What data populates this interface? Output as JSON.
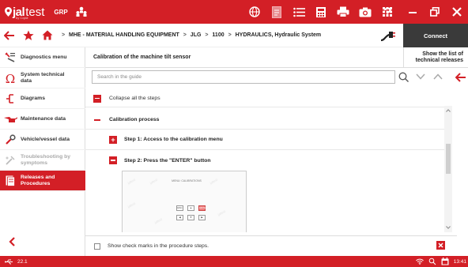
{
  "app": {
    "logo_primary": "jal",
    "logo_secondary": "test",
    "logo_subtitle": "by Cojali",
    "product": "GRP"
  },
  "breadcrumb": {
    "items": [
      "MHE - MATERIAL HANDLING EQUIPMENT",
      "JLG",
      "1100",
      "HYDRAULICS, Hydraulic System"
    ],
    "separator": ">"
  },
  "connect_label": "Connect",
  "sidebar": {
    "items": [
      {
        "label": "Diagnostics menu",
        "icon": "wrench-list-icon",
        "state": "normal"
      },
      {
        "label": "System technical data",
        "icon": "omega-icon",
        "state": "normal"
      },
      {
        "label": "Diagrams",
        "icon": "circuit-icon",
        "state": "normal"
      },
      {
        "label": "Maintenance data",
        "icon": "oil-can-icon",
        "state": "normal"
      },
      {
        "label": "Vehicle/vessel data",
        "icon": "car-wrench-icon",
        "state": "normal"
      },
      {
        "label": "Troubleshooting by symptoms",
        "icon": "troubleshoot-icon",
        "state": "disabled"
      },
      {
        "label": "Releases and Procedures",
        "icon": "document-icon",
        "state": "active"
      }
    ]
  },
  "main": {
    "title": "Calibration of the machine tilt sensor",
    "release_button": "Show the list of technical releases",
    "search_placeholder": "Search in the guide",
    "collapse_label": "Collapse all the steps",
    "process_label": "Calibration process",
    "steps": [
      {
        "label": "Step 1: Access to the calibration menu",
        "expanded": false
      },
      {
        "label": "Step 2: Press the \"ENTER\" button",
        "expanded": true
      }
    ],
    "figure": {
      "title": "MENU: CALIBRATIONS",
      "keys_row1": [
        "ESC",
        "▲",
        "ENTER"
      ],
      "keys_row2": [
        "◀",
        "▼",
        "▶"
      ]
    },
    "check_label": "Show check marks in the procedure steps."
  },
  "status": {
    "version": "22.1",
    "time": "13:41"
  },
  "colors": {
    "brand": "#d31f26",
    "connect_bg": "#3a3a3a"
  }
}
